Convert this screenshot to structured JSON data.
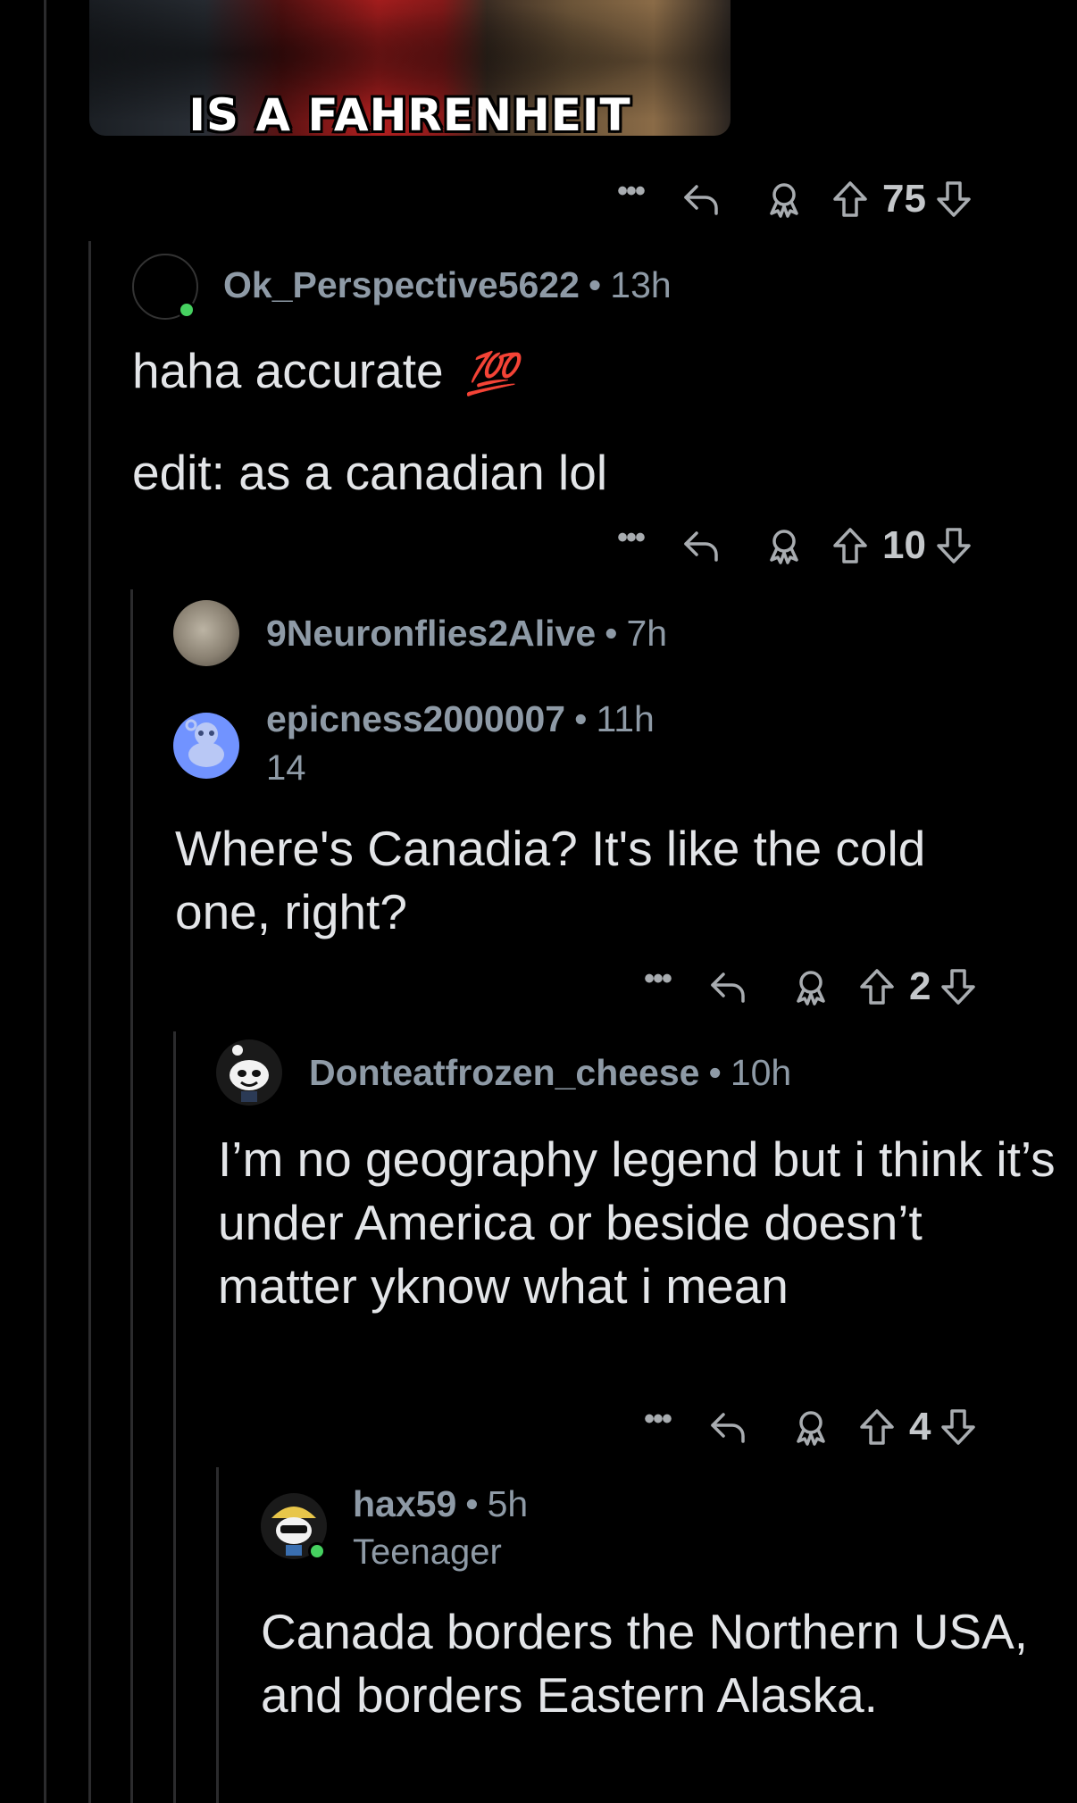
{
  "meme": {
    "caption": "IS A FAHRENHEIT"
  },
  "comments": [
    {
      "id": "c0",
      "actions": {
        "more": "•••",
        "votes": "75"
      }
    },
    {
      "id": "c1",
      "username": "Ok_Perspective5622",
      "separator": "•",
      "time": "13h",
      "lines": [
        "haha accurate",
        "edit: as a canadian lol"
      ],
      "emoji": "💯",
      "actions": {
        "more": "•••",
        "votes": "10"
      }
    },
    {
      "id": "c2",
      "username": "9Neuronflies2Alive",
      "separator": "•",
      "time": "7h"
    },
    {
      "id": "c3",
      "username": "epicness2000007",
      "separator": "•",
      "time": "11h",
      "flair": "14",
      "text": "Where's Canadia? It's like the cold one, right?",
      "actions": {
        "more": "•••",
        "votes": "2"
      }
    },
    {
      "id": "c4",
      "username": "Donteatfrozen_cheese",
      "separator": "•",
      "time": "10h",
      "text": "I’m no geography legend but i think it’s under America or beside doesn’t matter yknow what i mean",
      "actions": {
        "more": "•••",
        "votes": "4"
      }
    },
    {
      "id": "c5",
      "username": "hax59",
      "separator": "•",
      "time": "5h",
      "flair": "Teenager",
      "text": "Canada borders the Northern USA, and borders Eastern Alaska."
    }
  ],
  "colors": {
    "background": "#000000",
    "thread_line": "#2b2b2d",
    "meta_text": "#8e9aa6",
    "body_text": "#e3e5e8",
    "online": "#46d160"
  }
}
